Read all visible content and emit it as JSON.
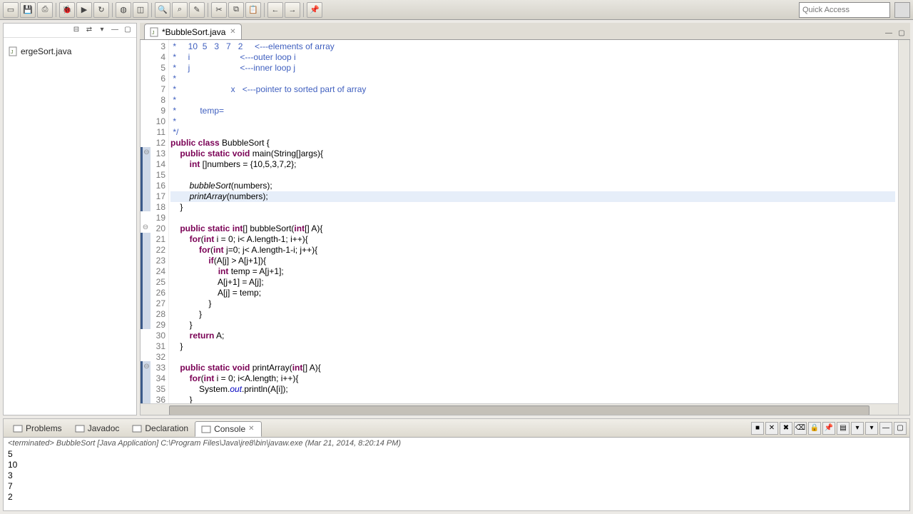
{
  "toolbar": {
    "quick_access_placeholder": "Quick Access"
  },
  "sidebar": {
    "items": [
      {
        "label": "ergeSort.java"
      }
    ]
  },
  "editor": {
    "tab": {
      "label": "*BubbleSort.java"
    },
    "first_line": 3,
    "active_line": 17,
    "fold_lines": [
      13,
      20,
      33
    ],
    "highlighted_gutter": [
      13,
      14,
      15,
      16,
      17,
      18,
      21,
      22,
      23,
      24,
      25,
      26,
      27,
      28,
      29,
      33,
      34,
      35,
      36
    ],
    "lines": [
      {
        "n": 3,
        "t": " *     10  5   3   7   2     <---elements of array",
        "cls": "cm"
      },
      {
        "n": 4,
        "t": " *     i                     <---outer loop i",
        "cls": "cm"
      },
      {
        "n": 5,
        "t": " *     j                     <---inner loop j",
        "cls": "cm"
      },
      {
        "n": 6,
        "t": " *",
        "cls": "cm"
      },
      {
        "n": 7,
        "t": " *                       x   <---pointer to sorted part of array",
        "cls": "cm"
      },
      {
        "n": 8,
        "t": " *",
        "cls": "cm"
      },
      {
        "n": 9,
        "t": " *          temp=",
        "cls": "cm"
      },
      {
        "n": 10,
        "t": " *",
        "cls": "cm"
      },
      {
        "n": 11,
        "t": " */",
        "cls": "cm"
      },
      {
        "n": 12,
        "html": "<span class='kw'>public class</span> BubbleSort {"
      },
      {
        "n": 13,
        "html": "    <span class='kw'>public static void</span> main(String[]args){"
      },
      {
        "n": 14,
        "html": "        <span class='kw'>int</span> []numbers = {10,5,3,7,2};"
      },
      {
        "n": 15,
        "t": ""
      },
      {
        "n": 16,
        "html": "        <span class='it'>bubbleSort</span>(numbers);"
      },
      {
        "n": 17,
        "html": "        <span class='it'>printArray</span>(numbers);"
      },
      {
        "n": 18,
        "t": "    }"
      },
      {
        "n": 19,
        "t": ""
      },
      {
        "n": 20,
        "html": "    <span class='kw'>public static int</span>[] bubbleSort(<span class='kw'>int</span>[] A){"
      },
      {
        "n": 21,
        "html": "        <span class='kw'>for</span>(<span class='kw'>int</span> i = 0; i&lt; A.length-1; i++){"
      },
      {
        "n": 22,
        "html": "            <span class='kw'>for</span>(<span class='kw'>int</span> j=0; j&lt; A.length-1-i; j++){"
      },
      {
        "n": 23,
        "html": "                <span class='kw'>if</span>(A[j] &gt; A[j+1]){"
      },
      {
        "n": 24,
        "html": "                    <span class='kw'>int</span> temp = A[j+1];"
      },
      {
        "n": 25,
        "t": "                    A[j+1] = A[j];"
      },
      {
        "n": 26,
        "t": "                    A[j] = temp;"
      },
      {
        "n": 27,
        "t": "                }"
      },
      {
        "n": 28,
        "t": "            }"
      },
      {
        "n": 29,
        "t": "        }"
      },
      {
        "n": 30,
        "html": "        <span class='kw'>return</span> A;"
      },
      {
        "n": 31,
        "t": "    }"
      },
      {
        "n": 32,
        "t": ""
      },
      {
        "n": 33,
        "html": "    <span class='kw'>public static void</span> printArray(<span class='kw'>int</span>[] A){"
      },
      {
        "n": 34,
        "html": "        <span class='kw'>for</span>(<span class='kw'>int</span> i = 0; i&lt;A.length; i++){"
      },
      {
        "n": 35,
        "html": "            System.<span class='str-it'>out</span>.println(A[i]);"
      },
      {
        "n": 36,
        "t": "        }"
      }
    ]
  },
  "console": {
    "tabs": [
      {
        "label": "Problems"
      },
      {
        "label": "Javadoc"
      },
      {
        "label": "Declaration"
      },
      {
        "label": "Console"
      }
    ],
    "active_tab": 3,
    "header": "<terminated> BubbleSort [Java Application] C:\\Program Files\\Java\\jre8\\bin\\javaw.exe (Mar 21, 2014, 8:20:14 PM)",
    "output": [
      "5",
      "10",
      "3",
      "7",
      "2"
    ]
  }
}
